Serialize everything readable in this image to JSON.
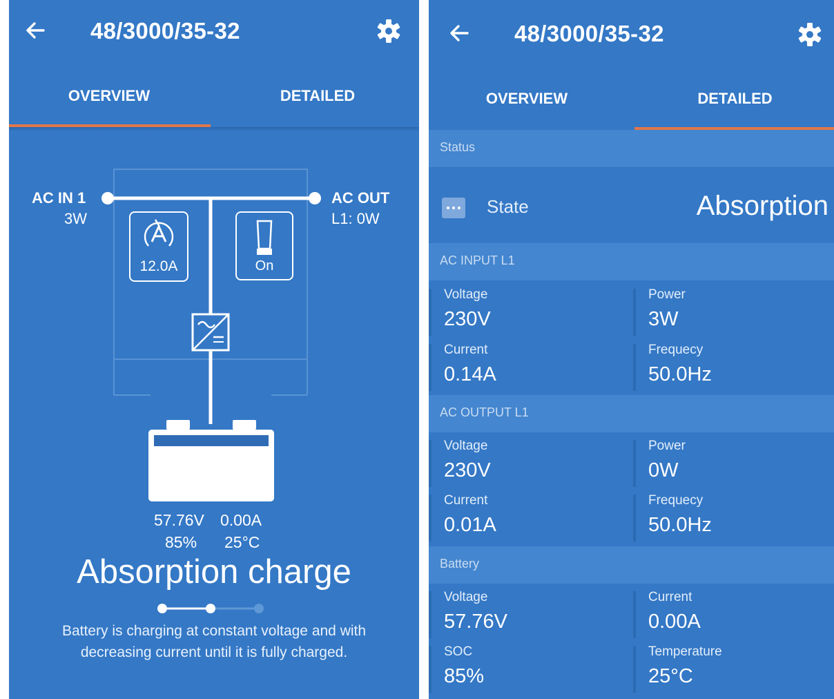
{
  "app": {
    "device_title": "48/3000/35-32",
    "tabs": [
      "OVERVIEW",
      "DETAILED"
    ],
    "colors": {
      "background": "#3478c6",
      "accent": "#e2764a",
      "section": "#4486cf"
    }
  },
  "overview": {
    "ac_in": {
      "label": "AC IN 1",
      "power": "3W"
    },
    "ac_out": {
      "label": "AC OUT",
      "power": "L1: 0W"
    },
    "current_limit": {
      "value": "12.0A",
      "icon": "current-limit-icon"
    },
    "switch": {
      "value": "On",
      "icon": "switch-icon"
    },
    "battery": {
      "voltage": "57.76V",
      "current": "0.00A",
      "soc": "85%",
      "temperature": "25°C"
    },
    "state_title": "Absorption charge",
    "state_description_line1": "Battery is charging at constant voltage and with",
    "state_description_line2": "decreasing current until it is fully charged.",
    "charge_stage": {
      "current_step": 2,
      "total_steps": 3
    }
  },
  "detailed": {
    "status": {
      "header": "Status",
      "state_label": "State",
      "state_value": "Absorption"
    },
    "ac_input": {
      "header": "AC INPUT L1",
      "voltage_label": "Voltage",
      "voltage": "230V",
      "power_label": "Power",
      "power": "3W",
      "current_label": "Current",
      "current": "0.14A",
      "frequency_label": "Frequecy",
      "frequency": "50.0Hz"
    },
    "ac_output": {
      "header": "AC OUTPUT L1",
      "voltage_label": "Voltage",
      "voltage": "230V",
      "power_label": "Power",
      "power": "0W",
      "current_label": "Current",
      "current": "0.01A",
      "frequency_label": "Frequecy",
      "frequency": "50.0Hz"
    },
    "battery": {
      "header": "Battery",
      "voltage_label": "Voltage",
      "voltage": "57.76V",
      "current_label": "Current",
      "current": "0.00A",
      "soc_label": "SOC",
      "soc": "85%",
      "temperature_label": "Temperature",
      "temperature": "25°C"
    }
  }
}
